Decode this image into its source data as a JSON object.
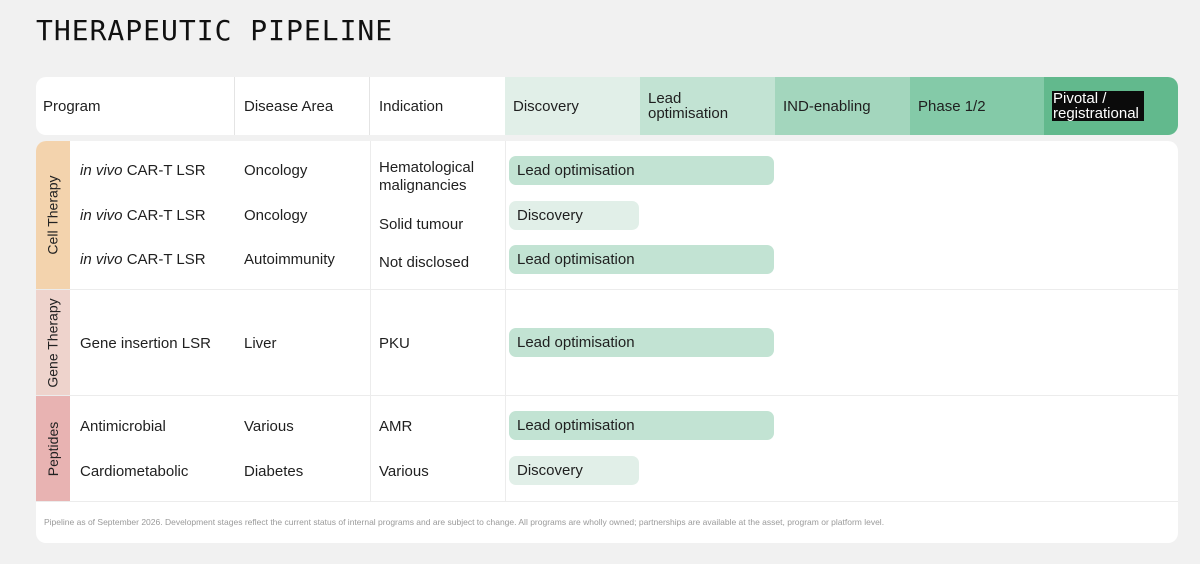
{
  "page": {
    "title": "THERAPEUTIC PIPELINE"
  },
  "header": {
    "program": "Program",
    "disease_area": "Disease Area",
    "indication": "Indication",
    "stages": [
      {
        "label": "Discovery",
        "color": "#e1efe8"
      },
      {
        "label": "Lead optimisation",
        "color": "#c2e3d3"
      },
      {
        "label": "IND-enabling",
        "color": "#a3d6bd"
      },
      {
        "label": "Phase 1/2",
        "color": "#84caa8"
      },
      {
        "label": "Pivotal / registrational",
        "color": "#62b98d"
      }
    ]
  },
  "sections": [
    {
      "name": "Cell Therapy",
      "color": "#f3d3ad",
      "rows": [
        {
          "program_prefix": "in vivo",
          "program": "CAR-T LSR",
          "disease_area": "Oncology",
          "indication": "Hematological malignancies",
          "stage": "Lead optimisation",
          "stage_index": 2
        },
        {
          "program_prefix": "in vivo",
          "program": "CAR-T LSR",
          "disease_area": "Oncology",
          "indication": "Solid tumour",
          "stage": "Discovery",
          "stage_index": 1
        },
        {
          "program_prefix": "in vivo",
          "program": "CAR-T LSR",
          "disease_area": "Autoimmunity",
          "indication": "Not disclosed",
          "stage": "Lead optimisation",
          "stage_index": 2
        }
      ]
    },
    {
      "name": "Gene Therapy",
      "color": "#eed3cc",
      "rows": [
        {
          "program_prefix": "",
          "program": "Gene insertion LSR",
          "disease_area": "Liver",
          "indication": "PKU",
          "stage": "Lead optimisation",
          "stage_index": 2
        }
      ]
    },
    {
      "name": "Peptides",
      "color": "#e8b3b2",
      "rows": [
        {
          "program_prefix": "",
          "program": "Antimicrobial",
          "disease_area": "Various",
          "indication": "AMR",
          "stage": "Lead optimisation",
          "stage_index": 2
        },
        {
          "program_prefix": "",
          "program": "Cardiometabolic",
          "disease_area": "Diabetes",
          "indication": "Various",
          "stage": "Discovery",
          "stage_index": 1
        }
      ]
    }
  ],
  "footnote": "Pipeline as of September 2026. Development stages reflect the current status of internal programs and are subject to change. All programs are wholly owned; partnerships are available at the asset, program or platform level.",
  "colors": {
    "discovery_bar": "#e1efe8",
    "lead_bar": "#c2e3d3"
  }
}
